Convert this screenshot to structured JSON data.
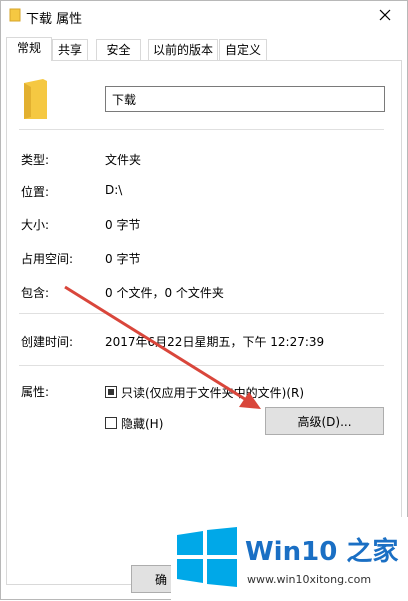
{
  "window": {
    "title": "下载 属性"
  },
  "tabs": [
    {
      "label": "常规",
      "active": true
    },
    {
      "label": "共享"
    },
    {
      "label": "安全"
    },
    {
      "label": "以前的版本"
    },
    {
      "label": "自定义"
    }
  ],
  "general": {
    "folder_name": "下载",
    "rows": [
      {
        "label": "类型:",
        "value": "文件夹"
      },
      {
        "label": "位置:",
        "value": "D:\\"
      },
      {
        "label": "大小:",
        "value": "0 字节"
      },
      {
        "label": "占用空间:",
        "value": "0 字节"
      },
      {
        "label": "包含:",
        "value": "0 个文件，0 个文件夹"
      }
    ],
    "created_label": "创建时间:",
    "created_value": "2017年6月22日星期五，下午 12:27:39",
    "attributes_label": "属性:",
    "readonly_label": "只读(仅应用于文件夹中的文件)(R)",
    "readonly_state": "indeterminate",
    "hidden_label": "隐藏(H)",
    "hidden_checked": false,
    "advanced_button": "高级(D)..."
  },
  "footer": {
    "ok_button": "确"
  },
  "watermark": {
    "brand": "Win10 之家",
    "url": "www.win10xitong.com"
  },
  "colors": {
    "folder": "#f5c842",
    "arrow": "#d9463b",
    "win_logo": "#00a8e8",
    "brand_blue": "#1a6fc4"
  }
}
